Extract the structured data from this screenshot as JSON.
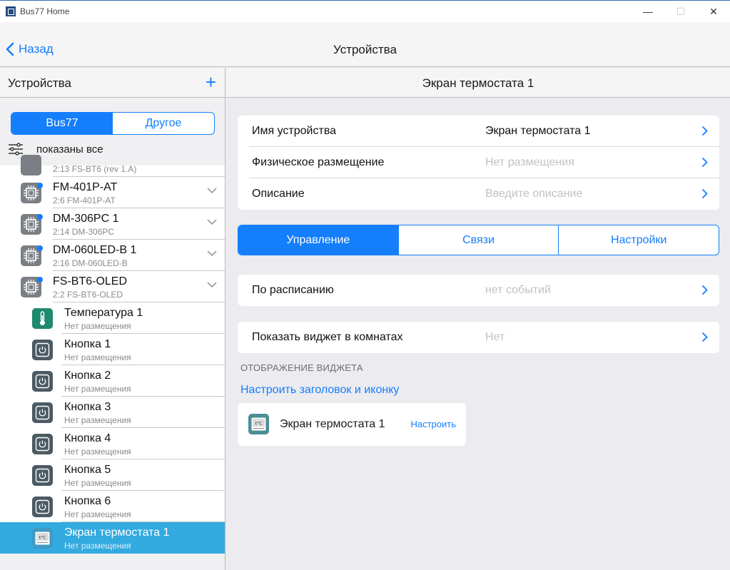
{
  "window": {
    "title": "Bus77 Home",
    "minimize": "—",
    "maximize": "☐",
    "close": "✕"
  },
  "nav": {
    "back_label": "Назад",
    "title": "Устройства"
  },
  "left": {
    "title": "Устройства",
    "add": "+",
    "segments": [
      "Bus77",
      "Другое"
    ],
    "filter_label": "показаны все",
    "items": [
      {
        "name": "",
        "sub": "2:13 FS-BT6 (rev 1.A)"
      },
      {
        "name": "FM-401P-AT",
        "sub": "2:6 FM-401P-AT"
      },
      {
        "name": "DM-306PC 1",
        "sub": "2:14 DM-306PC"
      },
      {
        "name": "DM-060LED-B 1",
        "sub": "2:16 DM-060LED-B"
      },
      {
        "name": "FS-BT6-OLED",
        "sub": "2:2 FS-BT6-OLED"
      }
    ],
    "children": [
      {
        "name": "Температура 1",
        "sub": "Нет размещения"
      },
      {
        "name": "Кнопка 1",
        "sub": "Нет размещения"
      },
      {
        "name": "Кнопка 2",
        "sub": "Нет размещения"
      },
      {
        "name": "Кнопка 3",
        "sub": "Нет размещения"
      },
      {
        "name": "Кнопка 4",
        "sub": "Нет размещения"
      },
      {
        "name": "Кнопка 5",
        "sub": "Нет размещения"
      },
      {
        "name": "Кнопка 6",
        "sub": "Нет размещения"
      },
      {
        "name": "Экран термостата 1",
        "sub": "Нет размещения"
      }
    ]
  },
  "right": {
    "title": "Экран термостата 1",
    "fields": [
      {
        "label": "Имя устройства",
        "value": "Экран термостата 1"
      },
      {
        "label": "Физическое размещение",
        "value": "Нет размещения"
      },
      {
        "label": "Описание",
        "value": "Введите описание"
      }
    ],
    "tabs": [
      "Управление",
      "Связи",
      "Настройки"
    ],
    "schedule": {
      "label": "По расписанию",
      "value": "нет событий"
    },
    "widget_rooms": {
      "label": "Показать виджет в комнатах",
      "value": "Нет"
    },
    "widget_section": "ОТОБРАЖЕНИЕ ВИДЖЕТА",
    "configure_link": "Настроить заголовок и иконку",
    "widget": {
      "name": "Экран термостата 1",
      "button": "Настроить"
    }
  },
  "icons": {
    "thermo_glyph": "t°C"
  },
  "colors": {
    "accent": "#147efb",
    "selected_row": "#33aae0",
    "thermo_green": "#1e8a6e",
    "badge_dot": "#147efb"
  }
}
